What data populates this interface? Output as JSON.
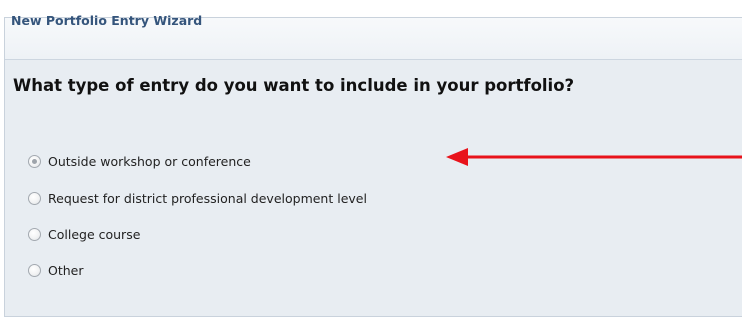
{
  "wizard": {
    "title": "New Portfolio Entry Wizard",
    "question": "What type of entry do you want to include in your portfolio?",
    "options": [
      {
        "label": "Outside workshop or conference",
        "selected": true
      },
      {
        "label": "Request for district professional development level",
        "selected": false
      },
      {
        "label": "College course",
        "selected": false
      },
      {
        "label": "Other",
        "selected": false
      }
    ]
  },
  "annotation": {
    "arrow_color": "#e8131b",
    "points_to": "Outside workshop or conference"
  }
}
